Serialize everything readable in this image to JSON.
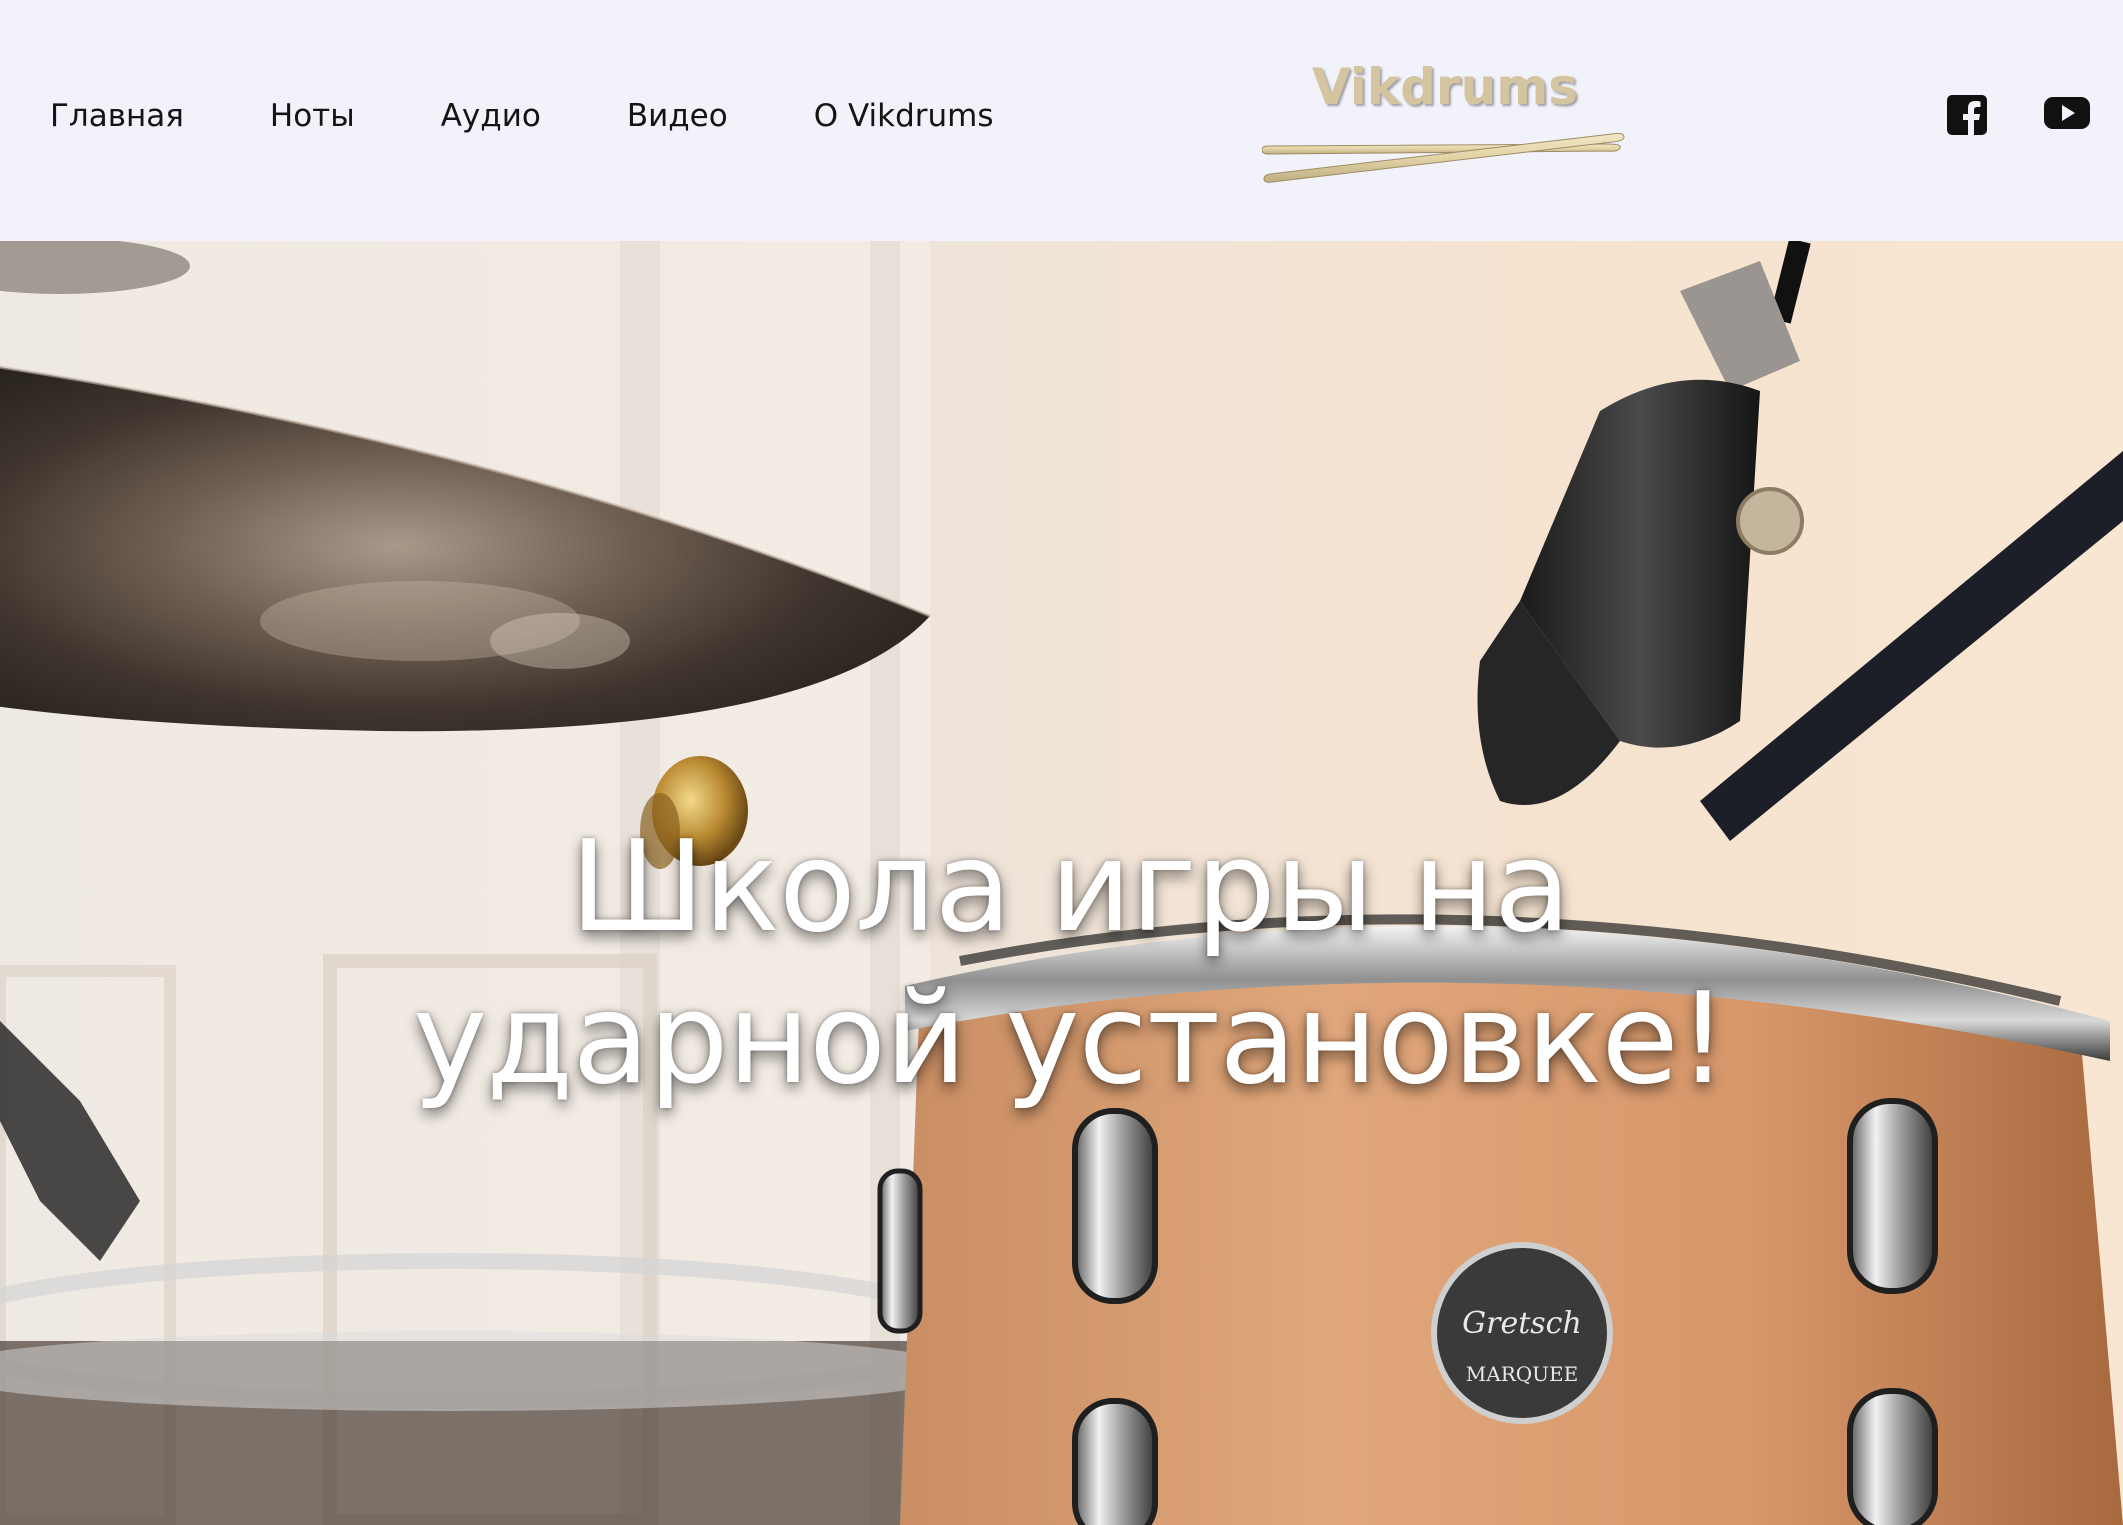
{
  "nav": {
    "items": [
      {
        "label": "Главная"
      },
      {
        "label": "Ноты"
      },
      {
        "label": "Аудио"
      },
      {
        "label": "Видео"
      },
      {
        "label": "О Vikdrums"
      }
    ]
  },
  "logo": {
    "text": "Vikdrums",
    "color": "#d4c5a0"
  },
  "social": {
    "facebook": {
      "icon": "facebook-icon"
    },
    "youtube": {
      "icon": "youtube-icon"
    }
  },
  "hero": {
    "title_line1": "Школа игры на",
    "title_line2": "ударной установке!",
    "drum_badge_brand": "Gretsch",
    "drum_badge_model": "MARQUEE"
  },
  "colors": {
    "header_bg": "#f2f2fb",
    "nav_text": "#141414",
    "hero_text": "#ffffff"
  }
}
